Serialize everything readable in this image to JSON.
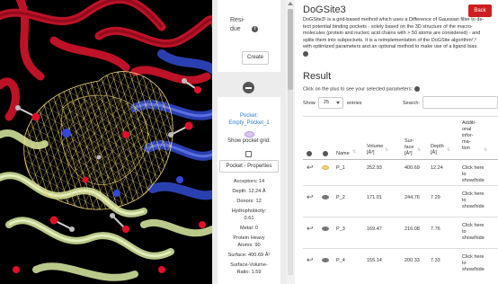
{
  "left_panel": {
    "residue_label_line1": "Resi-",
    "residue_label_line2": "due",
    "info_symbol": "i",
    "create_label": "Create"
  },
  "pocket": {
    "title_line1": "Pocket:",
    "title_line2": "Empty_Pocket_1",
    "show_grid_label": "Show pocket grid:",
    "properties_label": "Pocket - Properties",
    "props": [
      "Acceptors: 14",
      "Depth: 12.24 Å",
      "Donors: 12",
      "Hydrophobicity:",
      "0.61",
      "Metal: 0",
      "Protein Heavy",
      "Atoms: 90",
      "Surface: 400.69 Å²",
      "Surface-Volume-",
      "Ratio: 1.59"
    ]
  },
  "header": {
    "title": "DoGSite3",
    "back_label": "Back",
    "desc_line1": "DoGSite3¹ is a grid-based method which uses a Difference of Gaussian filter to de-",
    "desc_line2": "tect potential binding pockets - solely based on the 3D structure of the macro-",
    "desc_line3": "molecules (protein and nucleic acid chains with > 50 atoms are considered) - and",
    "desc_line4": "splits them into subpockets. It is a reimplementation of the DoGSite algorithm²,³",
    "desc_line5": "with optimized parameters and an optional method to make use of a ligand bias."
  },
  "result": {
    "title": "Result",
    "hint": "Click on the plus to see your selected parameters:",
    "show_label": "Show",
    "entries_value": "25",
    "entries_label": "entries",
    "search_label": "Search:",
    "search_value": ""
  },
  "table": {
    "headers": {
      "name": "Name",
      "volume_1": "Volume",
      "volume_2": "[Å³]",
      "surface_1": "Sur-",
      "surface_2": "face",
      "surface_3": "[Å²]",
      "depth_1": "Depth",
      "depth_2": "[Å]",
      "additional_1": "Additi-",
      "additional_2": "onal",
      "additional_3": "infor-",
      "additional_4": "ma-",
      "additional_5": "tion"
    },
    "rows": [
      {
        "name": "P_1",
        "volume": "252.93",
        "surface": "400.69",
        "depth": "12.24",
        "action_1": "Click here",
        "action_2": "to",
        "action_3": "show/hide",
        "selected": true
      },
      {
        "name": "P_2",
        "volume": "171.01",
        "surface": "244.76",
        "depth": "7.29",
        "action_1": "Click here",
        "action_2": "to",
        "action_3": "show/hide",
        "selected": false
      },
      {
        "name": "P_3",
        "volume": "169.47",
        "surface": "216.08",
        "depth": "7.76",
        "action_1": "Click here",
        "action_2": "to",
        "action_3": "show/hide",
        "selected": false
      },
      {
        "name": "P_4",
        "volume": "155.14",
        "surface": "200.33",
        "depth": "7.33",
        "action_1": "Click here",
        "action_2": "to",
        "action_3": "show/hide",
        "selected": false
      }
    ]
  },
  "colors": {
    "back_button": "#cc1f1f",
    "link": "#2a7fd0",
    "pocket_mesh": "#f2d67a",
    "protein_red": "#c8142a",
    "protein_blue": "#2a3fb0"
  }
}
